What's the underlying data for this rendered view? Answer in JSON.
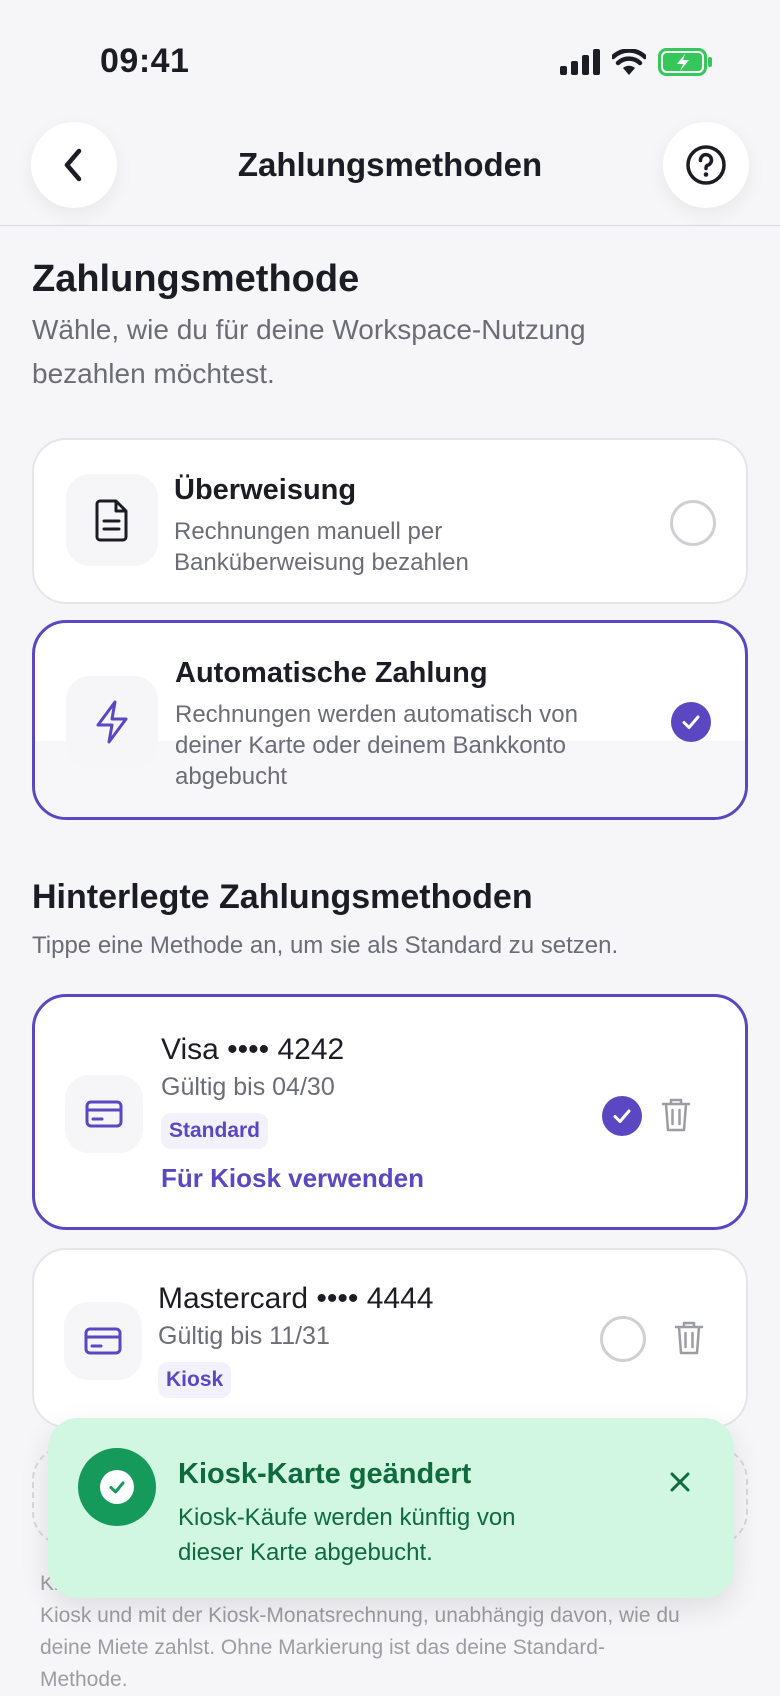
{
  "status_bar": {
    "time": "09:41"
  },
  "header": {
    "title": "Zahlungsmethoden",
    "back_icon": "chevron-left-icon",
    "help_icon": "help-circle-icon"
  },
  "payment_method_section": {
    "title": "Zahlungsmethode",
    "description_line1": "Wähle, wie du für deine Workspace-Nutzung",
    "description_line2": "bezahlen möchtest.",
    "options": [
      {
        "title": "Überweisung",
        "sub_line1": "Rechnungen manuell per",
        "sub_line2": "Banküberweisung bezahlen",
        "icon": "document-icon",
        "selected": false
      },
      {
        "title": "Automatische Zahlung",
        "sub_line1": "Rechnungen werden automatisch von",
        "sub_line2": "deiner Karte oder deinem Bankkonto",
        "sub_line3": "abgebucht",
        "icon": "lightning-icon",
        "selected": true
      }
    ]
  },
  "saved_methods_section": {
    "title": "Hinterlegte Zahlungsmethoden",
    "description": "Tippe eine Methode an, um sie als Standard zu setzen.",
    "methods": [
      {
        "title": "Visa •••• 4242",
        "expiry": "Gültig bis 04/30",
        "badge": "Standard",
        "link": "Für Kiosk verwenden",
        "selected": true
      },
      {
        "title": "Mastercard •••• 4444",
        "expiry": "Gültig bis 11/31",
        "badge": "Kiosk",
        "selected": false
      }
    ]
  },
  "footnote": {
    "line1": "Ki",
    "line2": "Kiosk und mit der Kiosk-Monatsrechnung, unabhängig davon, wie du",
    "line3": "deine Miete zahlst. Ohne Markierung ist das deine Standard-",
    "line4": "Methode."
  },
  "toast": {
    "title": "Kiosk-Karte geändert",
    "message_line1": "Kiosk-Käufe werden künftig von",
    "message_line2": "dieser Karte abgebucht."
  },
  "colors": {
    "accent": "#5b47c2",
    "toast_bg": "#d1f6e1",
    "toast_text": "#0e6b3e",
    "toast_icon": "#159a5c",
    "battery": "#34c759"
  }
}
